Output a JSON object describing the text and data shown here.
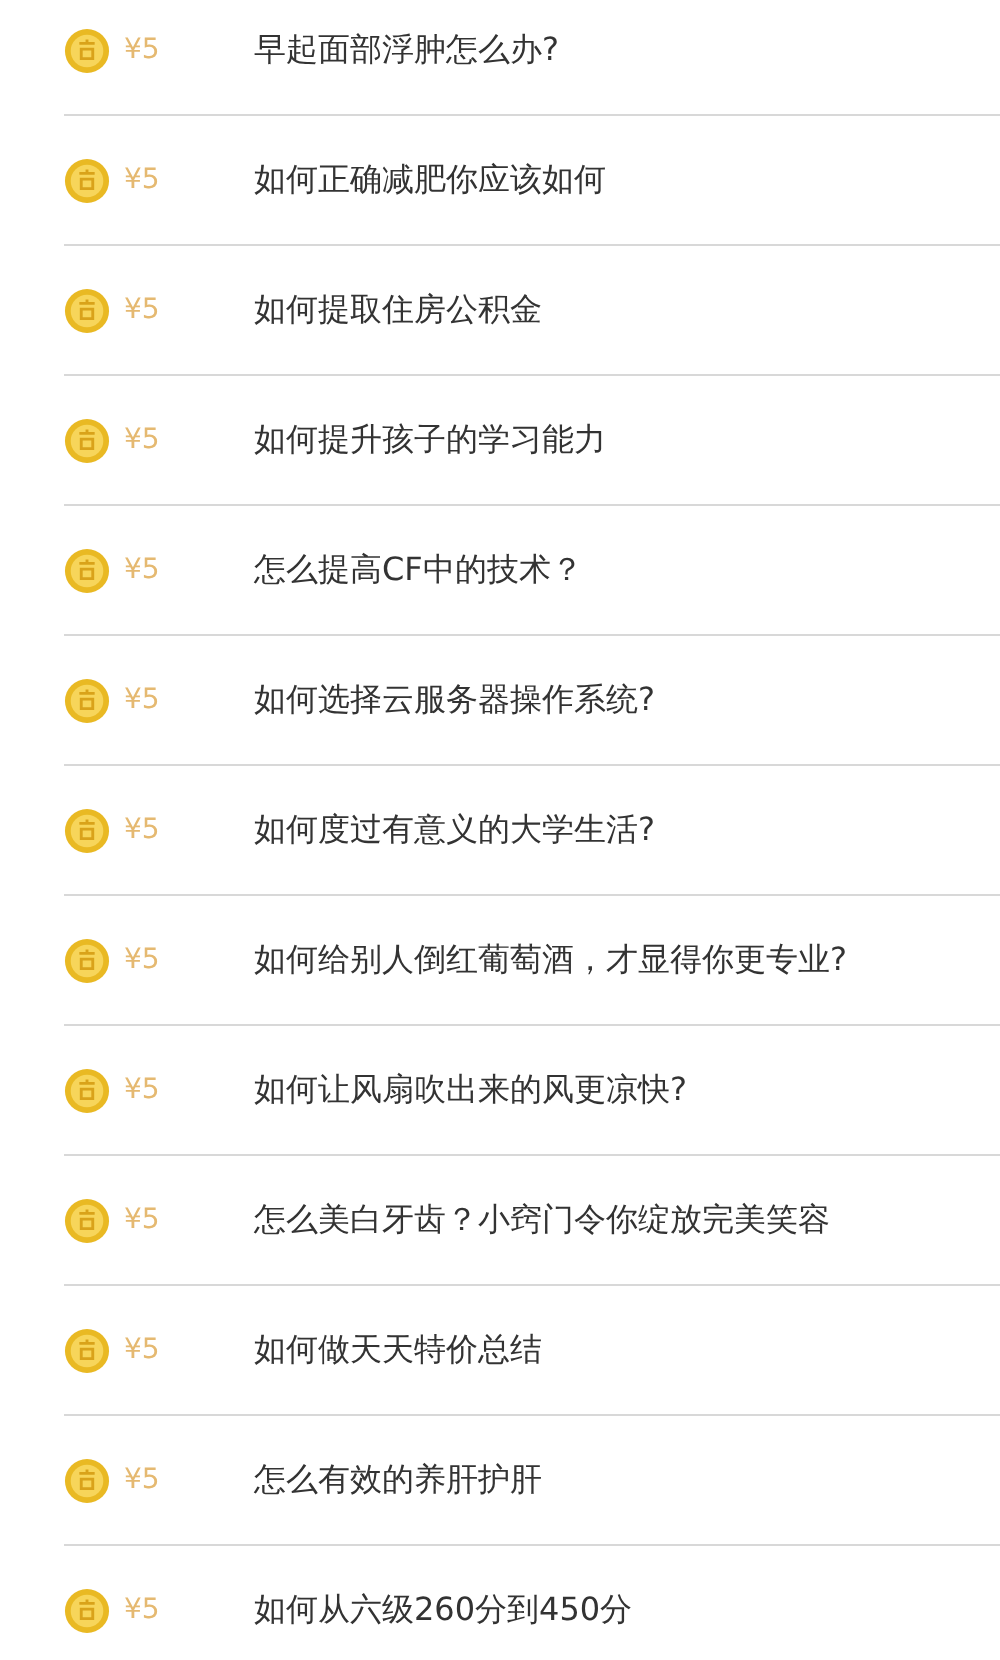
{
  "questions": [
    {
      "price": "¥5",
      "title": "早起面部浮肿怎么办?"
    },
    {
      "price": "¥5",
      "title": "如何正确减肥你应该如何"
    },
    {
      "price": "¥5",
      "title": "如何提取住房公积金"
    },
    {
      "price": "¥5",
      "title": "如何提升孩子的学习能力"
    },
    {
      "price": "¥5",
      "title": "怎么提高CF中的技术？"
    },
    {
      "price": "¥5",
      "title": "如何选择云服务器操作系统?"
    },
    {
      "price": "¥5",
      "title": "如何度过有意义的大学生活?"
    },
    {
      "price": "¥5",
      "title": "如何给别人倒红葡萄酒，才显得你更专业?"
    },
    {
      "price": "¥5",
      "title": "如何让风扇吹出来的风更凉快?"
    },
    {
      "price": "¥5",
      "title": "怎么美白牙齿？小窍门令你绽放完美笑容"
    },
    {
      "price": "¥5",
      "title": "如何做天天特价总结"
    },
    {
      "price": "¥5",
      "title": "怎么有效的养肝护肝"
    },
    {
      "price": "¥5",
      "title": "如何从六级260分到450分"
    }
  ]
}
